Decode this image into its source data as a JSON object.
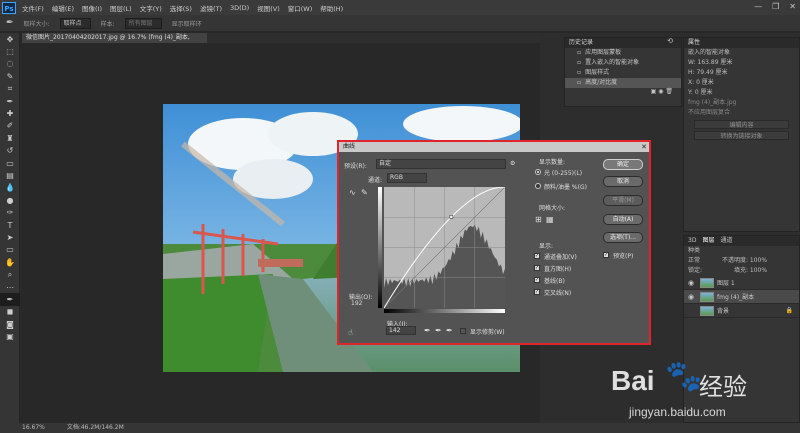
{
  "menubar": {
    "logo": "Ps",
    "items": [
      "文件(F)",
      "编辑(E)",
      "图像(I)",
      "图层(L)",
      "文字(Y)",
      "选择(S)",
      "滤镜(T)",
      "3D(D)",
      "视图(V)",
      "窗口(W)",
      "帮助(H)"
    ],
    "controls": [
      "—",
      "❐",
      "✕"
    ]
  },
  "options": {
    "sample_size_label": "取样大小:",
    "sample_size": "取样点",
    "sample_label": "样本:",
    "sample": "所有图层",
    "show_ring": "显示取样环"
  },
  "document": {
    "tab": "微信图片_20170404202017.jpg @ 16.7% (fmg (4)_副本, RGB/8) *",
    "close": "×"
  },
  "status": {
    "zoom": "16.67%",
    "doc": "文档:46.2M/146.2M"
  },
  "history": {
    "title": "历史记录",
    "items": [
      "应用图层蒙板",
      "置入嵌入的智能对象",
      "图层样式",
      "高度/对比度"
    ]
  },
  "properties": {
    "title": "属性",
    "object": "嵌入的智能对象",
    "w_label": "W:",
    "w": "163.89 厘米",
    "h_label": "H:",
    "h": "79.49 厘米",
    "x_label": "X:",
    "x": "0 厘米",
    "y_label": "Y:",
    "y": "0 厘米",
    "file": "fmg (4)_副本.jpg",
    "no_comp": "不应用图层复合",
    "edit_btn": "编辑内容",
    "convert_btn": "转换为链接对象"
  },
  "layers": {
    "tabs": [
      "3D",
      "图层",
      "通道"
    ],
    "kind": "种类",
    "blend": "正常",
    "opacity_label": "不透明度:",
    "opacity": "100%",
    "lock_label": "锁定:",
    "fill_label": "填充:",
    "fill": "100%",
    "items": [
      {
        "name": "图层 1",
        "selected": false
      },
      {
        "name": "fmg (4)_副本",
        "selected": true
      },
      {
        "name": "背景",
        "selected": false
      }
    ]
  },
  "curves": {
    "title": "曲线",
    "close": "✕",
    "preset_label": "预设(R):",
    "preset": "自定",
    "channel_label": "通道:",
    "channel": "RGB",
    "output_label": "输出(O):",
    "output_value": "192",
    "input_label": "输入(I):",
    "input_value": "142",
    "show_clipping": "显示修剪(W)",
    "display_amount": "显示数量:",
    "light": "光 (0-255)(L)",
    "pigment": "颜料/油墨 %(G)",
    "grid_size": "网格大小:",
    "show": "显示:",
    "show_options": [
      "通道叠加(V)",
      "直方图(H)",
      "基线(B)",
      "交叉线(N)"
    ],
    "buttons": {
      "ok": "确定",
      "cancel": "取消",
      "smooth": "平滑(M)",
      "auto": "自动(A)",
      "options": "选项(T)...",
      "preview": "预览(P)"
    },
    "curve_point": {
      "input": 142,
      "output": 192
    }
  },
  "watermark": {
    "text1": "Bai",
    "text2": "经验",
    "url": "jingyan.baidu.com"
  },
  "colors": {
    "accent": "#e0242b",
    "panel": "#353535",
    "bg": "#282828"
  }
}
